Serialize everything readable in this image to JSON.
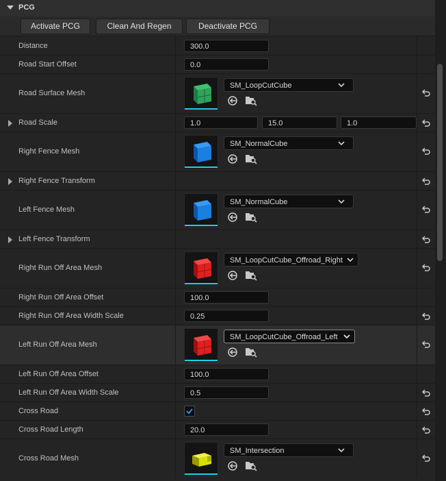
{
  "category": {
    "title": "PCG"
  },
  "buttons": {
    "activate": "Activate PCG",
    "clean": "Clean And Regen",
    "deactivate": "Deactivate PCG"
  },
  "rows": {
    "distance": {
      "label": "Distance",
      "value": "300.0"
    },
    "road_start_offset": {
      "label": "Road Start Offset",
      "value": "0.0"
    },
    "road_surface_mesh": {
      "label": "Road Surface Mesh",
      "asset": "SM_LoopCutCube",
      "thumb_color": "#2fa35a"
    },
    "road_scale": {
      "label": "Road Scale",
      "x": "1.0",
      "y": "15.0",
      "z": "1.0"
    },
    "right_fence_mesh": {
      "label": "Right Fence Mesh",
      "asset": "SM_NormalCube",
      "thumb_color": "#1a7fe0"
    },
    "right_fence_transform": {
      "label": "Right Fence Transform"
    },
    "left_fence_mesh": {
      "label": "Left Fence Mesh",
      "asset": "SM_NormalCube",
      "thumb_color": "#1a7fe0"
    },
    "left_fence_transform": {
      "label": "Left Fence Transform"
    },
    "right_run_off_mesh": {
      "label": "Right Run Off Area Mesh",
      "asset": "SM_LoopCutCube_Offroad_Right",
      "thumb_color": "#e02020"
    },
    "right_run_off_offset": {
      "label": "Right Run Off Area Offset",
      "value": "100.0"
    },
    "right_run_off_width": {
      "label": "Right Run Off Area Width Scale",
      "value": "0.25"
    },
    "left_run_off_mesh": {
      "label": "Left Run Off Area Mesh",
      "asset": "SM_LoopCutCube_Offroad_Left",
      "thumb_color": "#e02020"
    },
    "left_run_off_offset": {
      "label": "Left Run Off Area Offset",
      "value": "100.0"
    },
    "left_run_off_width": {
      "label": "Left Run Off Area Width Scale",
      "value": "0.5"
    },
    "cross_road": {
      "label": "Cross Road",
      "checked": true
    },
    "cross_road_length": {
      "label": "Cross Road Length",
      "value": "20.0"
    },
    "cross_road_mesh": {
      "label": "Cross Road Mesh",
      "asset": "SM_Intersection",
      "thumb_color": "#d8e000"
    }
  },
  "icons": {
    "reset": "reset-to-default-icon",
    "use_selected": "use-selected-asset-icon",
    "browse": "browse-to-asset-icon",
    "combo": "chevron-down-icon",
    "expand": "expand-arrow-icon"
  },
  "colors": {
    "accent_cyan": "#1fd1f0",
    "check_blue": "#2a8cff"
  }
}
